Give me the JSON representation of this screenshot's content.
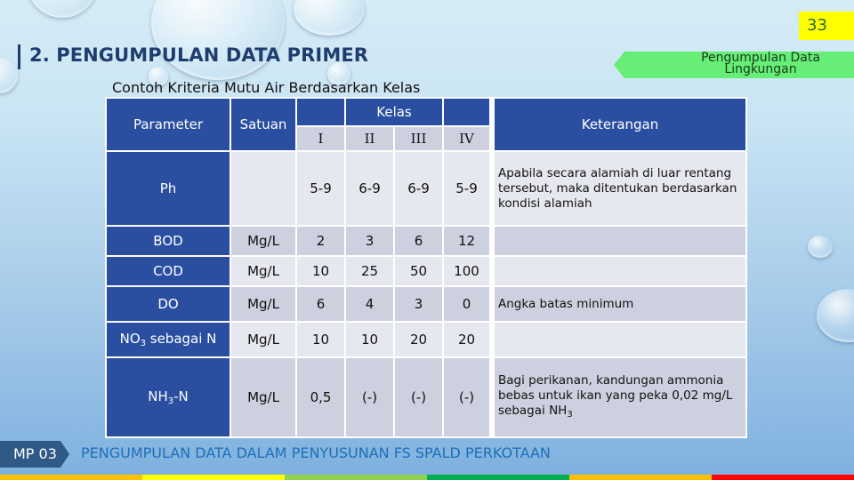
{
  "page_number": "33",
  "slide_title": "2. PENGUMPULAN DATA PRIMER",
  "section_tag": "Pengumpulan Data Lingkungan",
  "caption": "Contoh Kriteria Mutu Air Berdasarkan Kelas",
  "table": {
    "headers": {
      "parameter": "Parameter",
      "satuan": "Satuan",
      "kelas": "Kelas",
      "kelas_sub": [
        "I",
        "II",
        "III",
        "IV"
      ],
      "keterangan": "Keterangan"
    },
    "rows": [
      {
        "parameter": "Ph",
        "sub": "",
        "suffix": "",
        "satuan": "",
        "values": [
          "5-9",
          "6-9",
          "6-9",
          "5-9"
        ],
        "keterangan": "Apabila secara alamiah di luar rentang tersebut, maka ditentukan berdasarkan kondisi alamiah",
        "ket_sub": ""
      },
      {
        "parameter": "BOD",
        "sub": "",
        "suffix": "",
        "satuan": "Mg/L",
        "values": [
          "2",
          "3",
          "6",
          "12"
        ],
        "keterangan": "",
        "ket_sub": ""
      },
      {
        "parameter": "COD",
        "sub": "",
        "suffix": "",
        "satuan": "Mg/L",
        "values": [
          "10",
          "25",
          "50",
          "100"
        ],
        "keterangan": "",
        "ket_sub": ""
      },
      {
        "parameter": "DO",
        "sub": "",
        "suffix": "",
        "satuan": "Mg/L",
        "values": [
          "6",
          "4",
          "3",
          "0"
        ],
        "keterangan": "Angka batas minimum",
        "ket_sub": ""
      },
      {
        "parameter": "NO",
        "sub": "3",
        "suffix": " sebagai N",
        "satuan": "Mg/L",
        "values": [
          "10",
          "10",
          "20",
          "20"
        ],
        "keterangan": "",
        "ket_sub": ""
      },
      {
        "parameter": "NH",
        "sub": "3",
        "suffix": "-N",
        "satuan": "Mg/L",
        "values": [
          "0,5",
          "(-)",
          "(-)",
          "(-)"
        ],
        "keterangan": "Bagi perikanan, kandungan ammonia bebas untuk ikan yang peka 0,02 mg/L sebagai NH",
        "ket_sub": "3"
      }
    ]
  },
  "footer": {
    "tag": "MP 03",
    "text": "PENGUMPULAN DATA DALAM PENYUSUNAN FS SPALD PERKOTAAN"
  },
  "colors": {
    "header_blue": "#2a4fa0",
    "page_number_bg": "#ffff00",
    "section_tag_bg": "#66ee77",
    "footer_text": "#1f6fb8",
    "strip": [
      "#ffc000",
      "#ffff00",
      "#92d050",
      "#00b050",
      "#ffc000",
      "#ff0000"
    ]
  }
}
